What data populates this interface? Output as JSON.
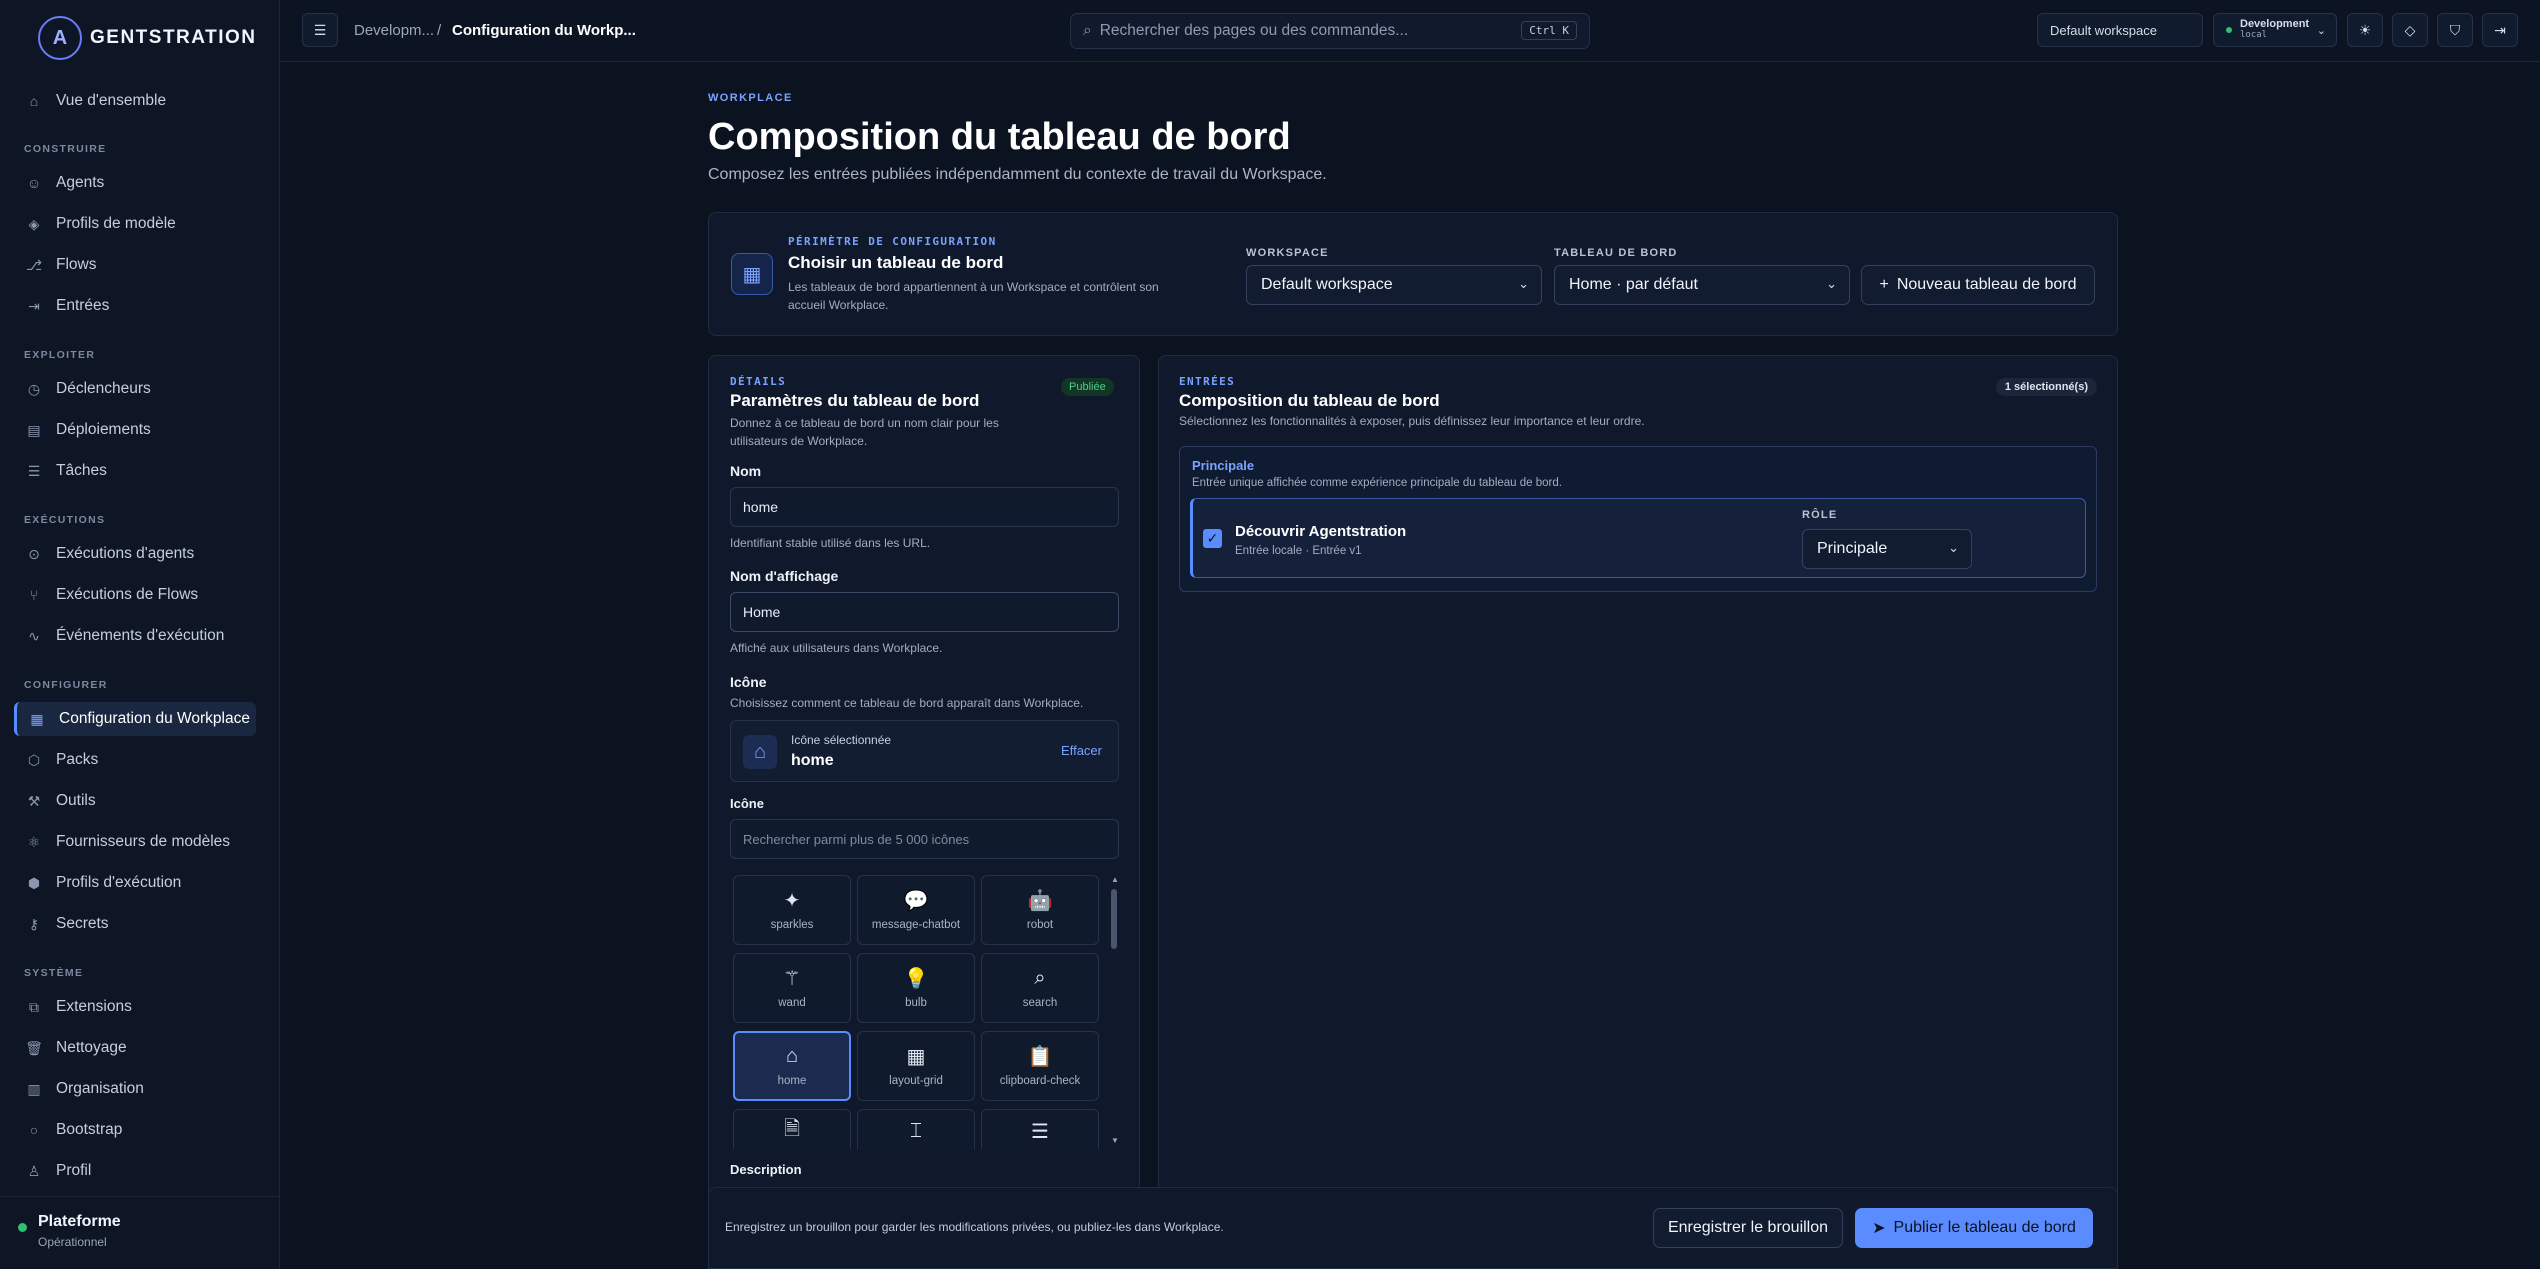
{
  "brand": {
    "name": "GENTSTRATION",
    "logo_letter": "A"
  },
  "sidebar": {
    "overview": "Vue d'ensemble",
    "sections": {
      "build": "CONSTRUIRE",
      "exploit": "EXPLOITER",
      "runs": "EXÉCUTIONS",
      "configure": "CONFIGURER",
      "system": "SYSTÈME"
    },
    "items": {
      "agents": "Agents",
      "model_profiles": "Profils de modèle",
      "flows": "Flows",
      "entries": "Entrées",
      "triggers": "Déclencheurs",
      "deployments": "Déploiements",
      "tasks": "Tâches",
      "agent_runs": "Exécutions d'agents",
      "flow_runs": "Exécutions de Flows",
      "run_events": "Événements d'exécution",
      "workplace_config": "Configuration du Workplace",
      "packs": "Packs",
      "tools": "Outils",
      "model_providers": "Fournisseurs de modèles",
      "exec_profiles": "Profils d'exécution",
      "secrets": "Secrets",
      "extensions": "Extensions",
      "cleanup": "Nettoyage",
      "organisation": "Organisation",
      "bootstrap": "Bootstrap",
      "profile": "Profil"
    },
    "platform": {
      "title": "Plateforme",
      "status": "Opérationnel",
      "status_color": "#2fbf71"
    }
  },
  "topbar": {
    "crumb_root": "Developm...",
    "crumb_sep": "/",
    "crumb_current": "Configuration du Workp...",
    "search_placeholder": "Rechercher des pages ou des commandes...",
    "search_shortcut": "Ctrl K",
    "workspace": "Default workspace",
    "env_name": "Development",
    "env_sub": "local"
  },
  "page": {
    "eyebrow": "WORKPLACE",
    "title": "Composition du tableau de bord",
    "subtitle": "Composez les entrées publiées indépendamment du contexte de travail du Workspace."
  },
  "scope": {
    "eyebrow": "PÉRIMÈTRE DE CONFIGURATION",
    "title": "Choisir un tableau de bord",
    "desc": "Les tableaux de bord appartiennent à un Workspace et contrôlent son accueil Workplace.",
    "workspace_label": "WORKSPACE",
    "workspace_value": "Default workspace",
    "dashboard_label": "TABLEAU DE BORD",
    "dashboard_value": "Home · par défaut",
    "new_button": "Nouveau tableau de bord"
  },
  "details": {
    "eyebrow": "DÉTAILS",
    "title": "Paramètres du tableau de bord",
    "desc": "Donnez à ce tableau de bord un nom clair pour les utilisateurs de Workplace.",
    "badge": "Publiée",
    "name_label": "Nom",
    "name_value": "home",
    "name_help": "Identifiant stable utilisé dans les URL.",
    "display_label": "Nom d'affichage",
    "display_value": "Home",
    "display_help": "Affiché aux utilisateurs dans Workplace.",
    "icon_label": "Icône",
    "icon_help": "Choisissez comment ce tableau de bord apparaît dans Workplace.",
    "selected_icon_label": "Icône sélectionnée",
    "selected_icon_value": "home",
    "clear": "Effacer",
    "icon_search_label": "Icône",
    "icon_search_placeholder": "Rechercher parmi plus de 5 000 icônes",
    "icons": [
      {
        "name": "sparkles",
        "glyph": "✦"
      },
      {
        "name": "message-chatbot",
        "glyph": "💬"
      },
      {
        "name": "robot",
        "glyph": "🤖"
      },
      {
        "name": "wand",
        "glyph": "⚚"
      },
      {
        "name": "bulb",
        "glyph": "💡"
      },
      {
        "name": "search",
        "glyph": "⌕"
      },
      {
        "name": "home",
        "glyph": "⌂"
      },
      {
        "name": "layout-grid",
        "glyph": "▦"
      },
      {
        "name": "clipboard-check",
        "glyph": "📋"
      },
      {
        "name": "",
        "glyph": "🗎"
      },
      {
        "name": "",
        "glyph": "⌶"
      },
      {
        "name": "",
        "glyph": "☰"
      }
    ],
    "description_label": "Description"
  },
  "entries": {
    "eyebrow": "ENTRÉES",
    "title": "Composition du tableau de bord",
    "desc": "Sélectionnez les fonctionnalités à exposer, puis définissez leur importance et leur ordre.",
    "count_badge": "1 sélectionné(s)",
    "group_title": "Principale",
    "group_desc": "Entrée unique affichée comme expérience principale du tableau de bord.",
    "item_title": "Découvrir Agentstration",
    "item_sub": "Entrée locale · Entrée v1",
    "role_label": "RÔLE",
    "role_value": "Principale"
  },
  "footer": {
    "hint": "Enregistrez un brouillon pour garder les modifications privées, ou publiez-les dans Workplace.",
    "save_draft": "Enregistrer le brouillon",
    "publish": "Publier le tableau de bord"
  },
  "colors": {
    "accent": "#5b8cff",
    "bg": "#0b1220",
    "success": "#2fbf71"
  }
}
